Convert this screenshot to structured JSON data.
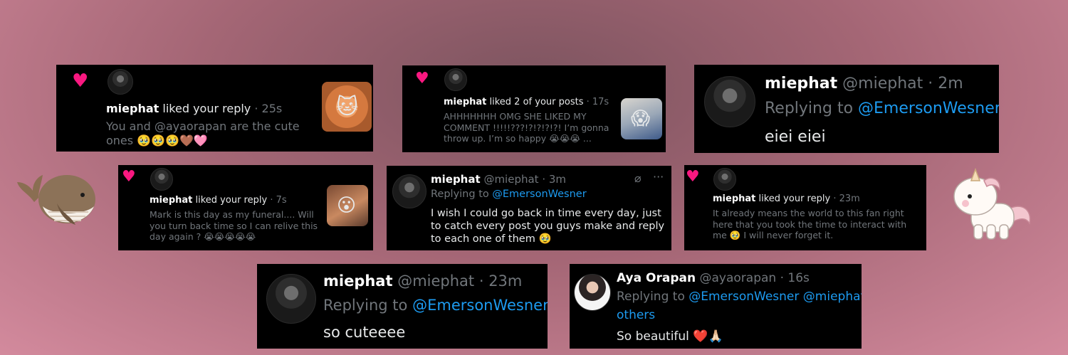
{
  "cards": {
    "c1": {
      "username": "miephat",
      "action": "liked your reply",
      "time": "· 25s",
      "text": "You and @ayaorapan are the cute ones 🥹🥹🥹🤎🩷"
    },
    "c2": {
      "username": "miephat",
      "action": "liked 2 of your posts",
      "time": "· 17s",
      "text": "AHHHHHHH OMG SHE LIKED MY COMMENT !!!!!???!?!?!?!?! I’m gonna throw up. I’m so happy 😭😭😭 ..."
    },
    "c3": {
      "username": "miephat",
      "handle": "@miephat",
      "time": "· 2m",
      "replying": "Replying to",
      "mention": "@EmersonWesner",
      "text": "eiei eiei"
    },
    "c4": {
      "username": "miephat",
      "action": "liked your reply",
      "time": "· 7s",
      "text": "Mark is this day as my funeral.... Will you turn back time so I can relive this day again ? 😭😭😭😭😭"
    },
    "c5": {
      "username": "miephat",
      "handle": "@miephat",
      "time": "· 3m",
      "replying": "Replying to",
      "mention": "@EmersonWesner",
      "text": "I wish I could go back in time every day, just to catch every post you guys make and reply to each one of them 🥹"
    },
    "c6": {
      "username": "miephat",
      "action": "liked your reply",
      "time": "· 23m",
      "text": "It already means the world to this fan right here that you took the time to interact with me 🥹 I will never forget it."
    },
    "c7": {
      "username": "miephat",
      "handle": "@miephat",
      "time": "· 23m",
      "replying": "Replying to",
      "mention": "@EmersonWesner",
      "text": "so cuteeee"
    },
    "c8": {
      "username": "Aya Orapan",
      "handle": "@ayaorapan",
      "time": "· 16s",
      "replying": "Replying to",
      "mention": "@EmersonWesner @miephat",
      "others": "others",
      "text": "So beautiful ❤️🙏🏻"
    }
  },
  "icons": {
    "heart": "heart-icon",
    "stickers": [
      "whale-sticker",
      "unicorn-sticker"
    ]
  },
  "colors": {
    "accent": "#f91880",
    "link": "#1d9bf0",
    "muted": "#71767b",
    "card": "#000000"
  }
}
